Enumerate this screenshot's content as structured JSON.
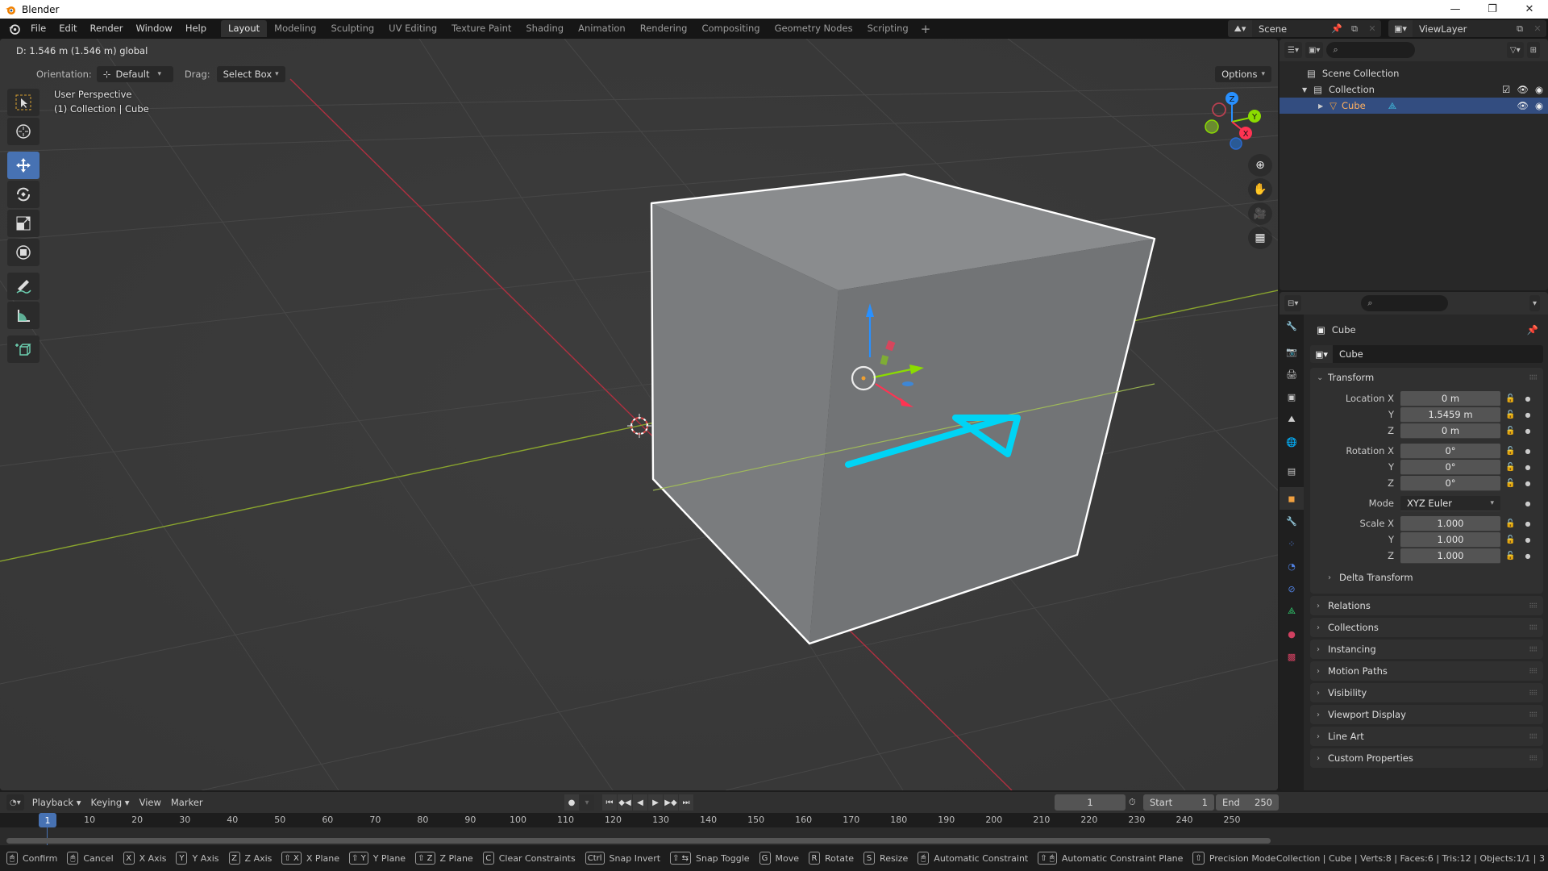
{
  "window": {
    "title": "Blender",
    "controls": {
      "minimize": "—",
      "maximize": "❐",
      "close": "✕"
    }
  },
  "menu": {
    "items": [
      "File",
      "Edit",
      "Render",
      "Window",
      "Help"
    ],
    "workspaces": [
      {
        "label": "Layout",
        "active": true
      },
      {
        "label": "Modeling",
        "active": false
      },
      {
        "label": "Sculpting",
        "active": false
      },
      {
        "label": "UV Editing",
        "active": false
      },
      {
        "label": "Texture Paint",
        "active": false
      },
      {
        "label": "Shading",
        "active": false
      },
      {
        "label": "Animation",
        "active": false
      },
      {
        "label": "Rendering",
        "active": false
      },
      {
        "label": "Compositing",
        "active": false
      },
      {
        "label": "Geometry Nodes",
        "active": false
      },
      {
        "label": "Scripting",
        "active": false
      }
    ],
    "add_workspace": "+",
    "scene": "Scene",
    "view_layer": "ViewLayer"
  },
  "viewport": {
    "header_status": "D: 1.546 m (1.546 m) global",
    "orientation_label": "Orientation:",
    "orientation_value": "Default",
    "drag_label": "Drag:",
    "drag_value": "Select Box",
    "options_label": "Options",
    "view_name": "User Perspective",
    "view_context": "(1) Collection | Cube",
    "gizmo_axes": {
      "x": "X",
      "y": "Y",
      "z": "Z"
    },
    "colors": {
      "x_axis": "#ff3352",
      "y_axis": "#8bdc00",
      "z_axis": "#2890ff",
      "annotation": "#00d4f5",
      "selection": "#ffffff",
      "active_tool": "#4772b3"
    }
  },
  "outliner": {
    "rows": [
      {
        "label": "Scene Collection"
      },
      {
        "label": "Collection"
      },
      {
        "label": "Cube",
        "selected": true
      }
    ]
  },
  "properties": {
    "object_name": "Cube",
    "data_name": "Cube",
    "transform": {
      "title": "Transform",
      "location": {
        "label": "Location X",
        "x": "0 m",
        "y": "1.5459 m",
        "z": "0 m"
      },
      "rotation": {
        "label": "Rotation X",
        "x": "0°",
        "y": "0°",
        "z": "0°"
      },
      "mode": {
        "label": "Mode",
        "value": "XYZ Euler"
      },
      "scale": {
        "label": "Scale X",
        "x": "1.000",
        "y": "1.000",
        "z": "1.000"
      },
      "axis_y": "Y",
      "axis_z": "Z"
    },
    "subpanel": "Delta Transform",
    "panels": [
      "Relations",
      "Collections",
      "Instancing",
      "Motion Paths",
      "Visibility",
      "Viewport Display",
      "Line Art",
      "Custom Properties"
    ]
  },
  "timeline": {
    "menus": [
      "Playback",
      "Keying",
      "View",
      "Marker"
    ],
    "current_frame": "1",
    "start_label": "Start",
    "start": "1",
    "end_label": "End",
    "end": "250",
    "ruler_ticks": [
      "10",
      "20",
      "30",
      "40",
      "50",
      "60",
      "70",
      "80",
      "90",
      "100",
      "110",
      "120",
      "130",
      "140",
      "150",
      "160",
      "170",
      "180",
      "190",
      "200",
      "210",
      "220",
      "230",
      "240",
      "250"
    ],
    "playhead": "1"
  },
  "statusbar": {
    "hints": [
      {
        "key": "🖱",
        "label": "Confirm"
      },
      {
        "key": "🖱",
        "label": "Cancel"
      },
      {
        "key": "X",
        "label": "X Axis"
      },
      {
        "key": "Y",
        "label": "Y Axis"
      },
      {
        "key": "Z",
        "label": "Z Axis"
      },
      {
        "key": "⇧ X",
        "label": "X Plane"
      },
      {
        "key": "⇧ Y",
        "label": "Y Plane"
      },
      {
        "key": "⇧ Z",
        "label": "Z Plane"
      },
      {
        "key": "C",
        "label": "Clear Constraints"
      },
      {
        "key": "Ctrl",
        "label": "Snap Invert"
      },
      {
        "key": "⇧ ⇆",
        "label": "Snap Toggle"
      },
      {
        "key": "G",
        "label": "Move"
      },
      {
        "key": "R",
        "label": "Rotate"
      },
      {
        "key": "S",
        "label": "Resize"
      },
      {
        "key": "🖱",
        "label": "Automatic Constraint"
      },
      {
        "key": "⇧ 🖱",
        "label": "Automatic Constraint Plane"
      },
      {
        "key": "⇧",
        "label": "Precision Mode"
      }
    ],
    "stats": "Collection | Cube | Verts:8 | Faces:6 | Tris:12 | Objects:1/1 | 3"
  }
}
